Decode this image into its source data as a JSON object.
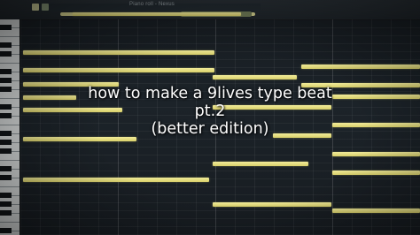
{
  "window": {
    "title": "Piano roll - Nexus"
  },
  "caption": {
    "line1": "how to make a 9lives type beat",
    "line2": "pt.2",
    "line3": "(better edition)"
  },
  "colors": {
    "note": "#e8e085",
    "grid_background": "#1c2329",
    "keyboard_white": "#d9dcdc"
  },
  "notes": [
    {
      "label": ""
    },
    {
      "label": ""
    },
    {
      "label": ""
    },
    {
      "label": ""
    },
    {
      "label": ""
    },
    {
      "label": ""
    },
    {
      "label": ""
    },
    {
      "label": ""
    },
    {
      "label": ""
    },
    {
      "label": ""
    },
    {
      "label": ""
    },
    {
      "label": ""
    },
    {
      "label": ""
    },
    {
      "label": ""
    },
    {
      "label": ""
    },
    {
      "label": ""
    },
    {
      "label": ""
    },
    {
      "label": ""
    },
    {
      "label": ""
    },
    {
      "label": ""
    }
  ]
}
